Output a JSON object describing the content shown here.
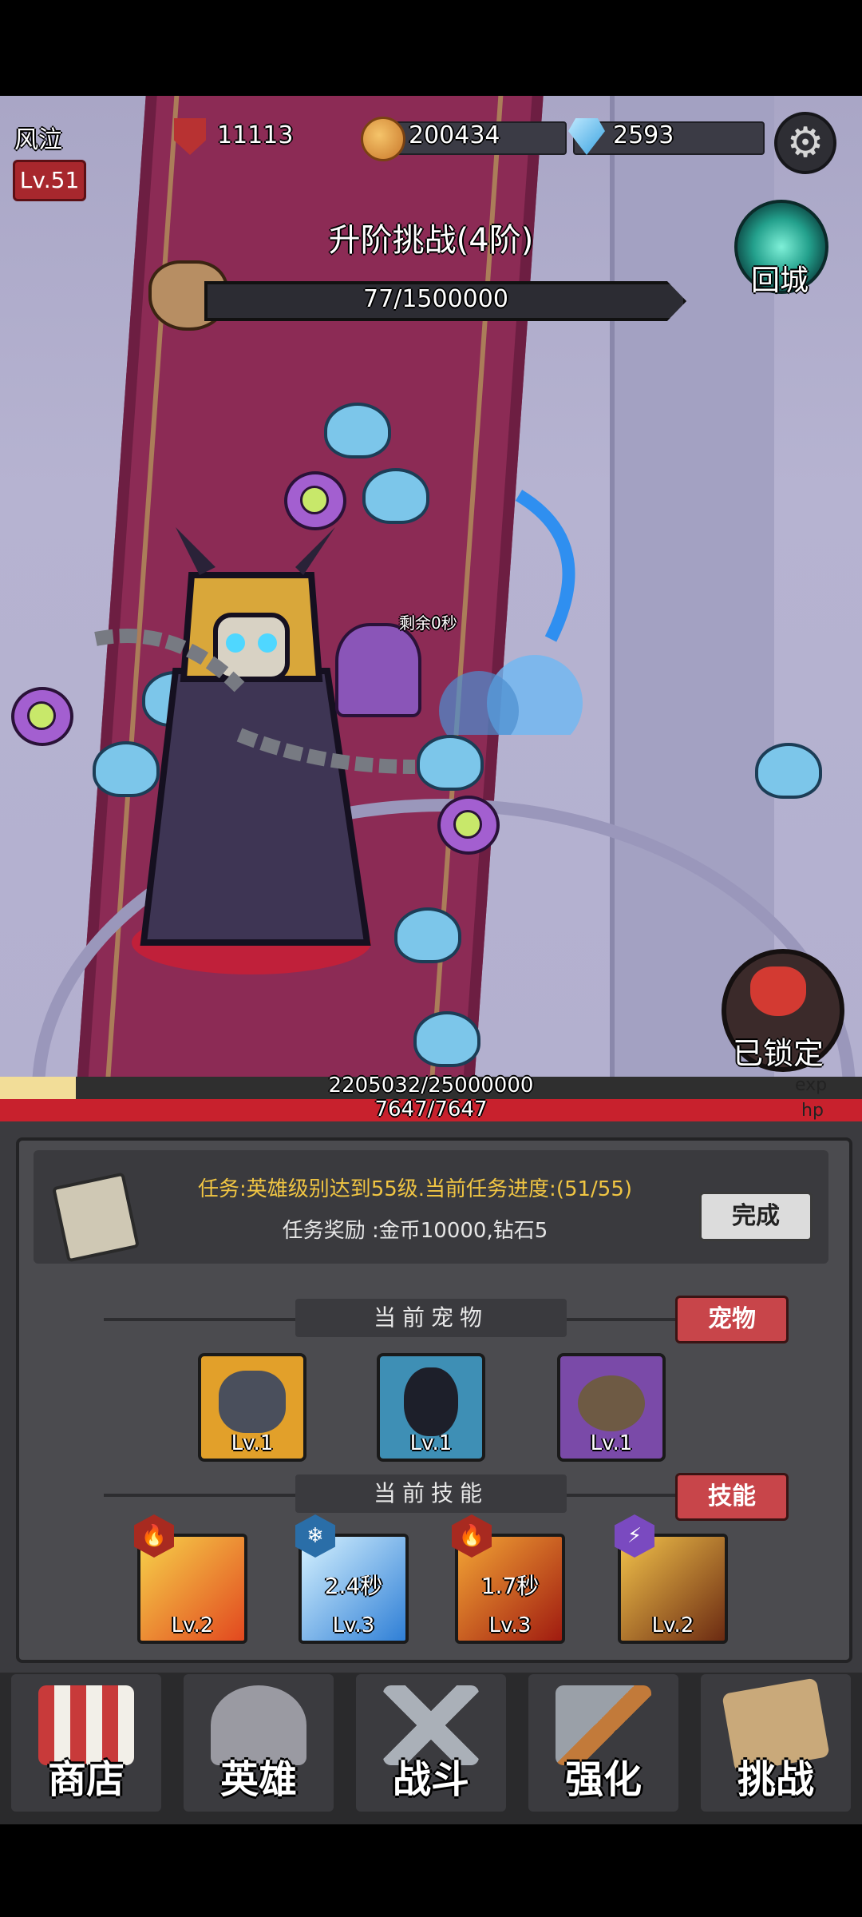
{
  "player": {
    "name": "风泣",
    "level": "Lv.51"
  },
  "resources": {
    "power": "11113",
    "gold": "200434",
    "gems": "2593"
  },
  "stage": {
    "title": "升阶挑战(4阶)",
    "boss_hp": "77/1500000",
    "timer": "剩余0秒"
  },
  "buttons": {
    "return_city": "回城",
    "locked": "已锁定"
  },
  "bars": {
    "exp_text": "2205032/25000000",
    "exp_label": "exp",
    "exp_fraction": 0.0882,
    "hp_text": "7647/7647",
    "hp_label": "hp",
    "hp_fraction": 1.0
  },
  "task": {
    "description": "任务:英雄级别达到55级.当前任务进度:(51/55)",
    "reward": "任务奖励 :金币10000,钻石5",
    "complete_label": "完成"
  },
  "pets": {
    "header": "当前宠物",
    "button": "宠物",
    "items": [
      {
        "level": "Lv.1",
        "color": "#e2a02a"
      },
      {
        "level": "Lv.1",
        "color": "#3e8fb5"
      },
      {
        "level": "Lv.1",
        "color": "#7a4aa8"
      }
    ]
  },
  "skills": {
    "header": "当前技能",
    "button": "技能",
    "items": [
      {
        "level": "Lv.2",
        "cooldown": "",
        "element_icon": "fire-icon",
        "badge": "🔥"
      },
      {
        "level": "Lv.3",
        "cooldown": "2.4秒",
        "element_icon": "snowflake-icon",
        "badge": "❄"
      },
      {
        "level": "Lv.3",
        "cooldown": "1.7秒",
        "element_icon": "fire-icon",
        "badge": "🔥"
      },
      {
        "level": "Lv.2",
        "cooldown": "",
        "element_icon": "lightning-icon",
        "badge": "⚡"
      }
    ]
  },
  "nav": [
    {
      "label": "商店",
      "icon": "shop-stall-icon"
    },
    {
      "label": "英雄",
      "icon": "viking-helmet-icon"
    },
    {
      "label": "战斗",
      "icon": "crossed-swords-icon"
    },
    {
      "label": "强化",
      "icon": "hammer-icon"
    },
    {
      "label": "挑战",
      "icon": "map-dagger-icon"
    }
  ],
  "colors": {
    "accent_red": "#c8454a",
    "task_yellow": "#f0c543",
    "hp_red": "#c8212d",
    "exp_yellow": "#f2dd98"
  }
}
